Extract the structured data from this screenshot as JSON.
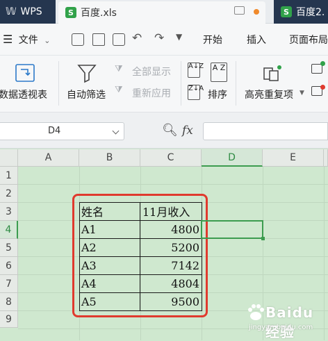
{
  "tabs": {
    "wps_label": "WPS",
    "file_label": "百度.xls",
    "other_label": "百度2.",
    "file_icon_letter": "S"
  },
  "menu": {
    "hamburger_label": "文件",
    "items": [
      "开始",
      "插入",
      "页面布局"
    ]
  },
  "ribbon": {
    "pivot_label": "数据透视表",
    "autofilter_label": "自动筛选",
    "show_all_label": "全部显示",
    "reapply_label": "重新应用",
    "sort_label": "排序",
    "highlight_dup_label": "高亮重复项"
  },
  "formula_bar": {
    "name_box": "D4",
    "fx_label": "fx"
  },
  "columns": [
    "A",
    "B",
    "C",
    "D",
    "E"
  ],
  "rows": [
    "1",
    "2",
    "3",
    "4",
    "5",
    "6",
    "7",
    "8",
    "9"
  ],
  "active_cell": "D4",
  "table": {
    "header": [
      "姓名",
      "11月收入"
    ],
    "rows": [
      [
        "A1",
        "4800"
      ],
      [
        "A2",
        "5200"
      ],
      [
        "A3",
        "7142"
      ],
      [
        "A4",
        "4804"
      ],
      [
        "A5",
        "9500"
      ]
    ]
  },
  "watermark": {
    "brand": "Baidu经验",
    "url": "jingyan.baidu.com"
  },
  "colors": {
    "sheet_bg": "#cfe8cf",
    "accent_green": "#3c9c4f",
    "highlight_red": "#e03a2e"
  }
}
